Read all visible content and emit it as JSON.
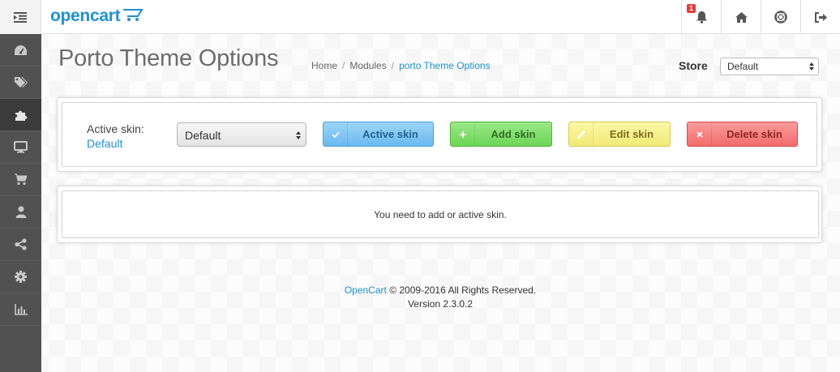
{
  "header": {
    "logo_text": "opencart",
    "notification_count": "1"
  },
  "page": {
    "title": "Porto Theme Options",
    "breadcrumb": [
      "Home",
      "Modules",
      "porto Theme Options"
    ]
  },
  "store": {
    "label": "Store",
    "selected": "Default"
  },
  "skin": {
    "label": "Active skin:",
    "current": "Default",
    "selected": "Default",
    "buttons": {
      "active": "Active skin",
      "add": "Add skin",
      "edit": "Edit skin",
      "delete": "Delete skin"
    }
  },
  "message": "You need to add or active skin.",
  "footer": {
    "brand": "OpenCart",
    "copyright": "© 2009-2016 All Rights Reserved.",
    "version": "Version 2.3.0.2"
  },
  "icons": {
    "menu": "menu-indent-icon",
    "bell": "bell-icon",
    "home": "home-icon",
    "support": "life-ring-icon",
    "logout": "sign-out-icon",
    "sidebar": [
      "dashboard-icon",
      "tags-icon",
      "puzzle-icon",
      "desktop-icon",
      "shopping-cart-icon",
      "user-icon",
      "share-icon",
      "cog-icon",
      "bar-chart-icon"
    ]
  },
  "colors": {
    "brand": "#1e91cf",
    "sidebar": "#515151",
    "active_btn": "#6ab9ef",
    "add_btn": "#6dd456",
    "edit_btn": "#f1ea76",
    "delete_btn": "#f26c6c"
  }
}
